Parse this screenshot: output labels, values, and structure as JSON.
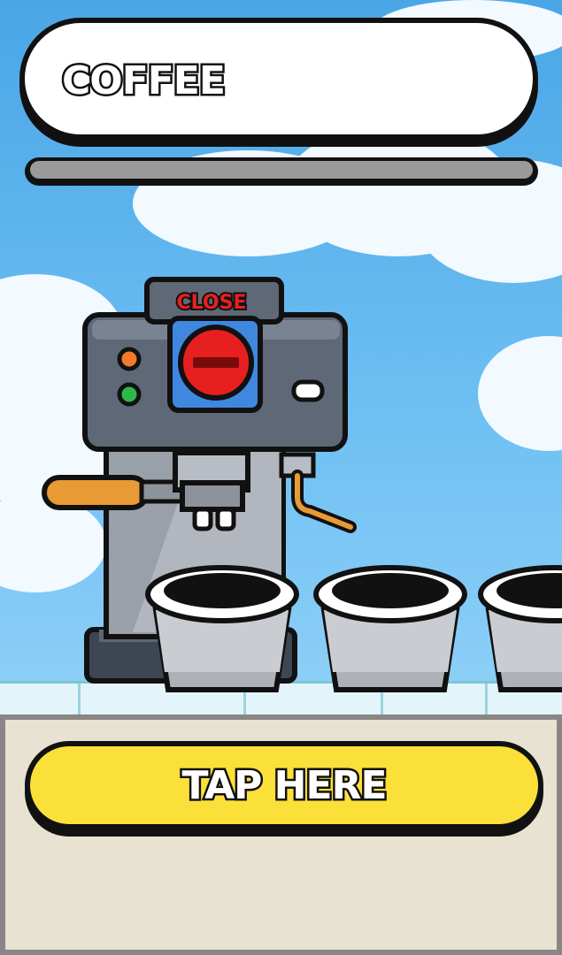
{
  "header": {
    "title": "COFFEE",
    "progress_fraction": 0
  },
  "machine": {
    "close_label": "CLOSE",
    "close_button_icon": "minus-icon",
    "indicator_colors": [
      "#f07a2a",
      "#2fb84a"
    ]
  },
  "cups": {
    "count_visible": 3
  },
  "action": {
    "tap_label": "TAP HERE"
  },
  "colors": {
    "button_yellow": "#fbe03a",
    "close_red": "#e81f1f",
    "close_panel_blue": "#3f88e0",
    "machine_gray": "#5f6877",
    "panel_beige": "#e7e2d1"
  }
}
